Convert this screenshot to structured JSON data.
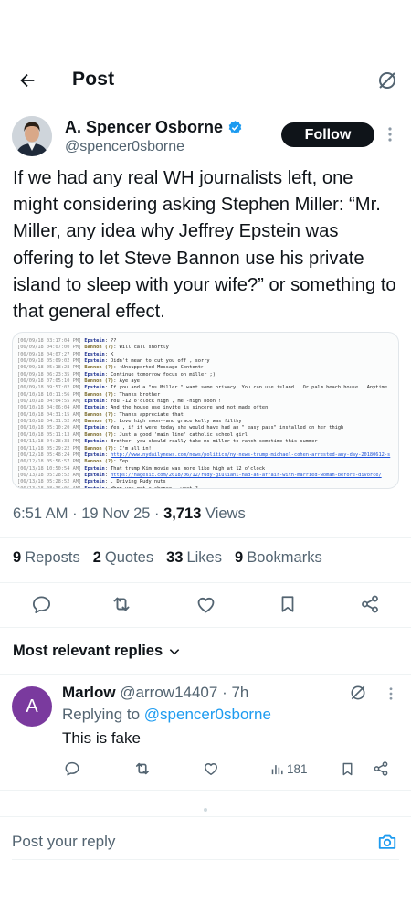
{
  "header": {
    "title": "Post",
    "back_icon": "arrow-left-icon",
    "grok_icon": "grok-icon"
  },
  "author": {
    "name": "A. Spencer Osborne",
    "handle": "@spencer0sborne",
    "verified": true,
    "follow_label": "Follow"
  },
  "tweet": {
    "text": "If we had any real WH journalists left, one might considering asking Stephen Miller: “Mr. Miller, any idea why Jeffrey Epstein was offering to let Steve Bannon use his private island to sleep with your wife?” or something to that general effect.",
    "image_lines": [
      {
        "ts": "[06/09/18 03:17:04 PM]",
        "name": "Epstein",
        "msg": "??"
      },
      {
        "ts": "[06/09/18 04:07:00 PM]",
        "name": "Bannon (?)",
        "msg": "Will call shortly"
      },
      {
        "ts": "[06/09/18 04:07:27 PM]",
        "name": "Epstein",
        "msg": "K"
      },
      {
        "ts": "[06/09/18 05:09:02 PM]",
        "name": "Epstein",
        "msg": "Didn't mean to cut you off , sorry"
      },
      {
        "ts": "[06/09/18 05:18:28 PM]",
        "name": "Bannon (?)",
        "msg": "<Unsupported Message Content>"
      },
      {
        "ts": "[06/09/18 06:23:35 PM]",
        "name": "Epstein",
        "msg": "Continue tomorrow focus on miller ;)"
      },
      {
        "ts": "[06/09/18 07:05:10 PM]",
        "name": "Bannon (?)",
        "msg": "Aye aye"
      },
      {
        "ts": "[06/09/18 09:57:02 PM]",
        "name": "Epstein",
        "msg": "If you and a \"ms Miller \" want some privacy. You can use island . Or palm beach house . Anytime"
      },
      {
        "ts": "[06/10/18 10:11:56 PM]",
        "name": "Bannon (?)",
        "msg": "Thanks brother"
      },
      {
        "ts": "[06/10/18 04:04:55 AM]",
        "name": "Epstein",
        "msg": "You -12 o'clock high , me -high noon !"
      },
      {
        "ts": "[06/10/18 04:06:04 AM]",
        "name": "Epstein",
        "msg": "And the house use invite is sincere and not made often"
      },
      {
        "ts": "[06/10/18 04:31:15 AM]",
        "name": "Bannon (?)",
        "msg": "Thanks appreciate that"
      },
      {
        "ts": "[06/10/18 04:31:52 AM]",
        "name": "Bannon (?)",
        "msg": "Love high noon--and grace kelly was filthy"
      },
      {
        "ts": "[06/10/18 05:10:20 AM]",
        "name": "Epstein",
        "msg": "Yes , if it were today she would have had an \" easy pass\" installed on her thigh"
      },
      {
        "ts": "[06/10/18 05:11:13 AM]",
        "name": "Bannon (?)",
        "msg": "Just a good 'main line' catholic school girl"
      },
      {
        "ts": "[06/11/18 04:28:38 PM]",
        "name": "Epstein",
        "msg": "Brother- you should really take ms miller to ranch sometime this summer"
      },
      {
        "ts": "[06/11/18 05:29:22 PM]",
        "name": "Bannon (?)",
        "msg": "I'm all in!"
      },
      {
        "ts": "[06/12/18 05:48:24 PM]",
        "name": "Epstein",
        "msg": "http://www.nydailynews.com/news/politics/ny-news-trump-michael-cohen-arrested-any-day-20180612-s",
        "link": true
      },
      {
        "ts": "[06/12/18 05:56:57 PM]",
        "name": "Bannon (?)",
        "msg": "Yep"
      },
      {
        "ts": "[06/13/18 10:50:54 AM]",
        "name": "Epstein",
        "msg": "That trump Kim movie was more like high at 12 o'clock"
      },
      {
        "ts": "[06/13/18 05:28:52 AM]",
        "name": "Epstein",
        "msg": "https://nagesix.com/2018/06/12/rudy-giuliani-had-an-affair-with-married-woman-before-divorce/",
        "link": true
      },
      {
        "ts": "[06/13/18 05:28:52 AM]",
        "name": "Epstein",
        "msg": ". Driving Rudy nuts"
      },
      {
        "ts": "[06/13/18 08:36:06 AM]",
        "name": "Epstein",
        "msg": "When you get a chance , what ?"
      },
      {
        "ts": "[06/13/18 08:36:53 AM]",
        "name": "Bannon (?)",
        "msg": "Yes will call"
      }
    ]
  },
  "meta": {
    "time": "6:51 AM",
    "date": "19 Nov 25",
    "views_count": "3,713",
    "views_label": "Views"
  },
  "stats": {
    "reposts_count": "9",
    "reposts_label": "Reposts",
    "quotes_count": "2",
    "quotes_label": "Quotes",
    "likes_count": "33",
    "likes_label": "Likes",
    "bookmarks_count": "9",
    "bookmarks_label": "Bookmarks"
  },
  "actions": [
    "reply-icon",
    "repost-icon",
    "like-icon",
    "bookmark-icon",
    "share-icon"
  ],
  "replies": {
    "sort_label": "Most relevant replies",
    "items": [
      {
        "avatar_letter": "A",
        "avatar_color": "#7a3a9e",
        "name": "Marlow",
        "handle": "@arrow14407",
        "time": "· 7h",
        "replying_to_label": "Replying to",
        "replying_to_handle": "@spencer0sborne",
        "text": "This is fake",
        "views": "181"
      }
    ]
  },
  "composer": {
    "placeholder": "Post your reply",
    "camera_icon": "camera-icon"
  },
  "colors": {
    "accent": "#1d9bf0",
    "text": "#0f1419",
    "secondary": "#536471",
    "follow_bg": "#0f1419"
  }
}
